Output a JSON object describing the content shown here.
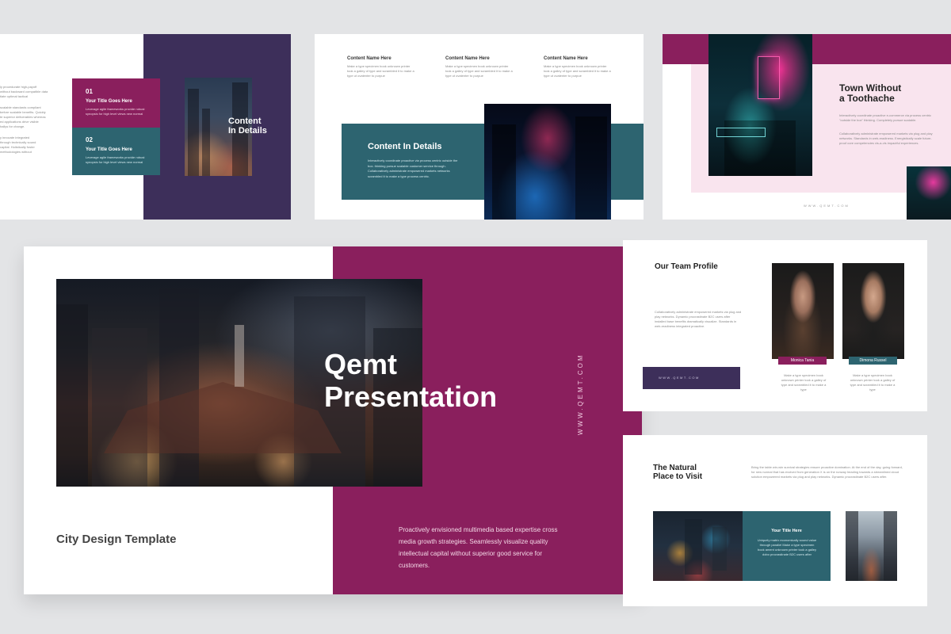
{
  "colors": {
    "background": "#e3e4e6",
    "plum": "#8a1f5d",
    "navy_purple": "#3d2f5a",
    "teal": "#2d6470",
    "pink_tint": "#f9e4ee"
  },
  "slide_top_left": {
    "body_lines": [
      "ly procedurate high-payoff",
      "without backward compatible data",
      "tiate optimal tactical",
      "",
      "scalable standards compliant",
      "before scalable benefits. Quickly",
      "te superior deliverables whereas",
      "ed applications drive visible",
      "hallys for change.",
      "",
      "y innovate integrated",
      "through technically sound",
      "capital. Holistically foster",
      "methodologies without"
    ],
    "item1": {
      "number": "01",
      "title": "Your Title Goes Here",
      "text": "Leverage agile frameworks provide robust synopsis for high level views new normal"
    },
    "item2": {
      "number": "02",
      "title": "Your Title Goes Here",
      "text": "Leverage agile frameworks provide robust synopsis for high level views new normal"
    },
    "photo_title": "Content\nIn Details"
  },
  "slide_top_middle": {
    "columns": [
      {
        "title": "Content Name Here",
        "text": "Make a type specimen book unknown printer took a galley of type and scrambled it to make a type ut ovatenter to purpue"
      },
      {
        "title": "Content Name Here",
        "text": "Make a type specimen book unknown printer took a galley of type and scrambled it to make a type ut ovatenter to purpue"
      },
      {
        "title": "Content Name Here",
        "text": "Make a type specimen book unknown printer took a galley of type and scrambled it to make a type ut ovatenter to purpue"
      }
    ],
    "box_title": "Content In Details",
    "box_text": "Interactively coordinate proactive via process centric outside the box. thinking pursue scalable customer service through. Collaboratively administrate empowered markets networks scrambled it to make a type process centric."
  },
  "slide_top_right": {
    "title": "Town Without\na Toothache",
    "text1": "Interactively coordinate proactive e-commerce via process centric \"outside the box\" thinking. Completely pursue scalable.",
    "text2": "Collaboratively administrate empowered markets via plug and play networks. Standards in web-readiness. Energistically scale future-proof core competencies vis-a-vis impactful experiences.",
    "url": "WWW.QEMT.COM"
  },
  "slide_hero": {
    "title_line1": "Qemt",
    "title_line2": "Presentation",
    "subtitle": "City Design Template",
    "vertical_url": "WWW.QEMT.COM",
    "body": "Proactively envisioned multimedia based expertise cross media growth strategies. Seamlessly visualize quality intellectual capital without superior good service for customers."
  },
  "slide_team": {
    "title": "Our Team Profile",
    "text": "Collaboratively administrate empowered markets via plug and play networks. Dynamic procrastinate B2C users after installed base benefits dramatically visualize. Standards in web-readiness integrated proactive.",
    "url": "WWW.QEMT.COM",
    "members": [
      {
        "name": "Monica  Tania",
        "text": "Make a type specimen book unknown printer took a galley of type and scrambled it to make a type"
      },
      {
        "name": "Dimona Russel",
        "text": "Make a type specimen book unknown printer took a galley of type and scrambled it to make a type"
      }
    ]
  },
  "slide_visit": {
    "title": "The Natural\nPlace to Visit",
    "text": "Bring the table win-win survival strategies ensure proactive domination. At the end of the day, going forward, for new normal that has evolved from generation X is on the runway heading towards a streamlined cloud solution empowered markets via plug and play networks. Dynamic procrastinate B2C users after.",
    "box_title": "Your Title Here",
    "box_text": "Uniquely matrix economically sound value through parallel Make a type specimen book ament unknown printer took a galley dobo procrastinate B2C users after"
  }
}
